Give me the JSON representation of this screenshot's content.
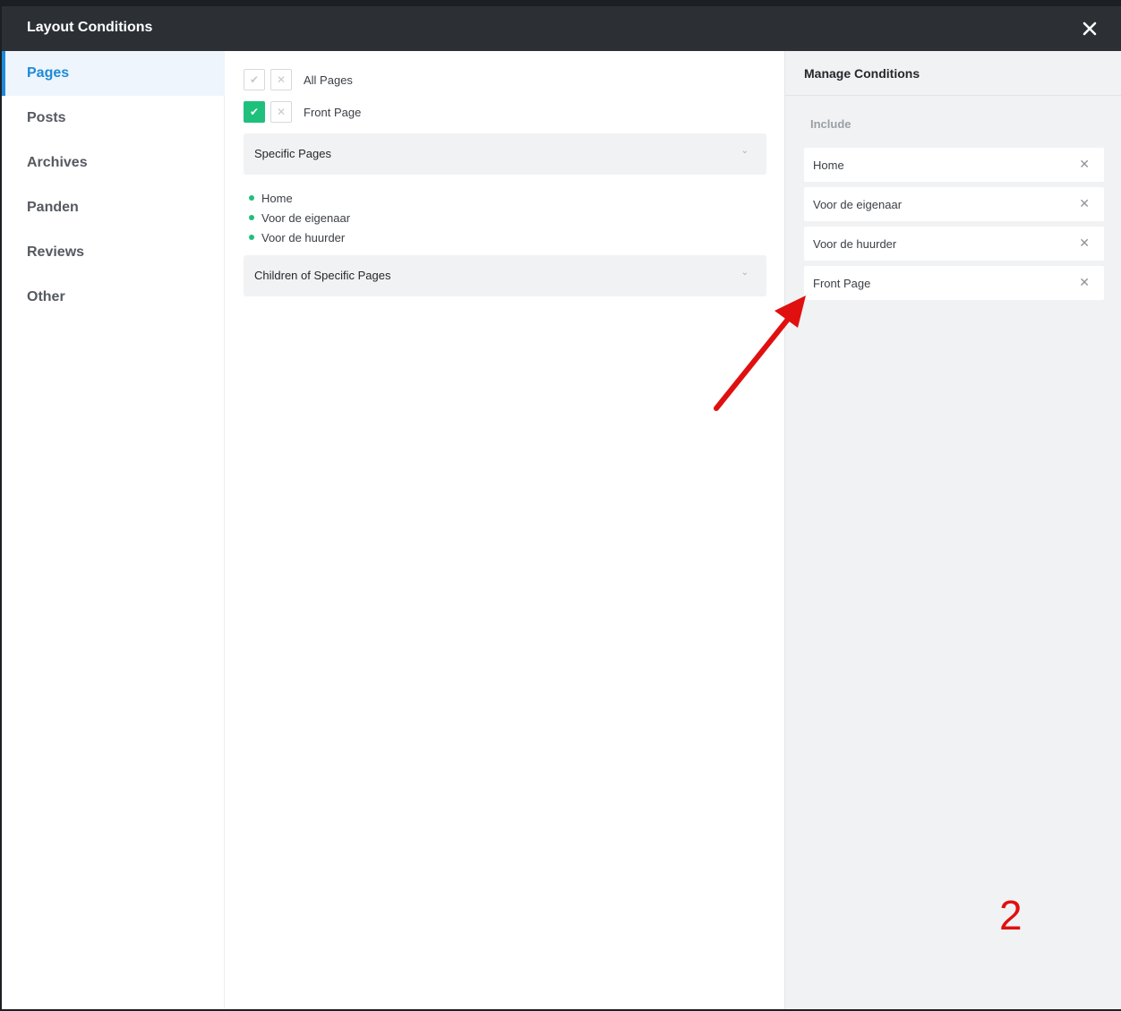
{
  "modal": {
    "title": "Layout Conditions"
  },
  "sidebar": {
    "items": [
      {
        "label": "Pages",
        "active": true
      },
      {
        "label": "Posts",
        "active": false
      },
      {
        "label": "Archives",
        "active": false
      },
      {
        "label": "Panden",
        "active": false
      },
      {
        "label": "Reviews",
        "active": false
      },
      {
        "label": "Other",
        "active": false
      }
    ]
  },
  "main": {
    "toggles": [
      {
        "label": "All Pages",
        "included": false
      },
      {
        "label": "Front Page",
        "included": true
      }
    ],
    "accordions": [
      {
        "label": "Specific Pages"
      },
      {
        "label": "Children of Specific Pages"
      }
    ],
    "specific_pages": [
      "Home",
      "Voor de eigenaar",
      "Voor de huurder"
    ]
  },
  "manage": {
    "title": "Manage Conditions",
    "section_label": "Include",
    "conditions": [
      "Home",
      "Voor de eigenaar",
      "Voor de huurder",
      "Front Page"
    ]
  },
  "annotation": {
    "step_number": "2"
  },
  "colors": {
    "accent": "#1d8bd8",
    "check_green": "#1ec07c",
    "annotation_red": "#e01010",
    "titlebar": "#2c3035"
  },
  "icons": {
    "close": "close-icon",
    "check": "check-icon",
    "exclude": "x-icon",
    "chevron": "chevron-down-icon",
    "remove": "remove-icon"
  }
}
